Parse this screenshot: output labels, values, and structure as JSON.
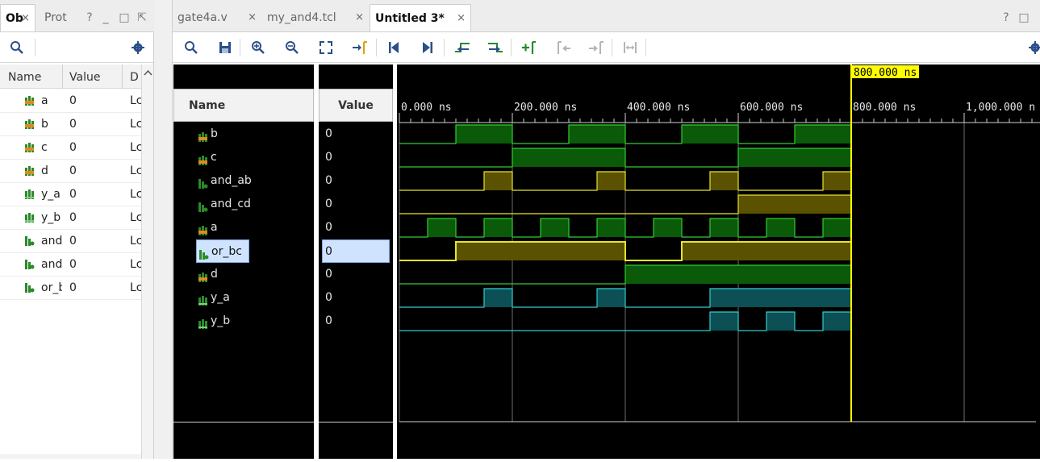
{
  "left_panel": {
    "tabs": [
      {
        "label": "Ob",
        "active": true,
        "close": "×"
      },
      {
        "label": "Prot",
        "active": false
      }
    ],
    "tab_controls": [
      "?",
      "_",
      "□",
      "⇱"
    ],
    "columns": [
      "Name",
      "Value",
      "D"
    ],
    "objects": [
      {
        "name": "a",
        "value": "0",
        "dir": "Lc",
        "icon": "input-icon"
      },
      {
        "name": "b",
        "value": "0",
        "dir": "Lc",
        "icon": "input-icon"
      },
      {
        "name": "c",
        "value": "0",
        "dir": "Lc",
        "icon": "input-icon"
      },
      {
        "name": "d",
        "value": "0",
        "dir": "Lc",
        "icon": "input-icon"
      },
      {
        "name": "y_a",
        "value": "0",
        "dir": "Lc",
        "icon": "output-icon"
      },
      {
        "name": "y_b",
        "value": "0",
        "dir": "Lc",
        "icon": "output-icon"
      },
      {
        "name": "and",
        "value": "0",
        "dir": "Lc",
        "icon": "internal-icon"
      },
      {
        "name": "and",
        "value": "0",
        "dir": "Lc",
        "icon": "internal-icon"
      },
      {
        "name": "or_b",
        "value": "0",
        "dir": "Lc",
        "icon": "internal-icon"
      }
    ]
  },
  "right_panel": {
    "tabs": [
      {
        "label": "gate4a.v",
        "active": false,
        "close": "×"
      },
      {
        "label": "my_and4.tcl",
        "active": false,
        "close": "×"
      },
      {
        "label": "Untitled 3*",
        "active": true,
        "close": "×"
      }
    ],
    "tab_controls": [
      "?",
      "□"
    ],
    "columns": {
      "name": "Name",
      "value": "Value"
    },
    "cursor_label": "800.000 ns",
    "time_ticks": [
      "0.000 ns",
      "200.000 ns",
      "400.000 ns",
      "600.000 ns",
      "800.000 ns",
      "1,000.000 n"
    ],
    "signals": [
      {
        "name": "b",
        "value": "0",
        "icon": "input-icon",
        "kind": "bus-green"
      },
      {
        "name": "c",
        "value": "0",
        "icon": "input-icon",
        "kind": "bus-green"
      },
      {
        "name": "and_ab",
        "value": "0",
        "icon": "internal-icon",
        "kind": "bus-yellow"
      },
      {
        "name": "and_cd",
        "value": "0",
        "icon": "internal-icon",
        "kind": "bus-yellow"
      },
      {
        "name": "a",
        "value": "0",
        "icon": "input-icon",
        "kind": "bus-green"
      },
      {
        "name": "or_bc",
        "value": "0",
        "icon": "internal-icon",
        "kind": "bus-yellow",
        "selected": true
      },
      {
        "name": "d",
        "value": "0",
        "icon": "input-icon",
        "kind": "bus-green"
      },
      {
        "name": "y_a",
        "value": "0",
        "icon": "output-icon",
        "kind": "bus-cyan"
      },
      {
        "name": "y_b",
        "value": "0",
        "icon": "output-icon",
        "kind": "bus-cyan"
      }
    ]
  },
  "colors": {
    "green_fill": "#0a5a0a",
    "green_line": "#33cc33",
    "yellow_fill": "#5a5200",
    "yellow_line": "#e5e52b",
    "cyan_fill": "#0c4f55",
    "cyan_line": "#33cccc",
    "cursor": "#ffff00"
  }
}
